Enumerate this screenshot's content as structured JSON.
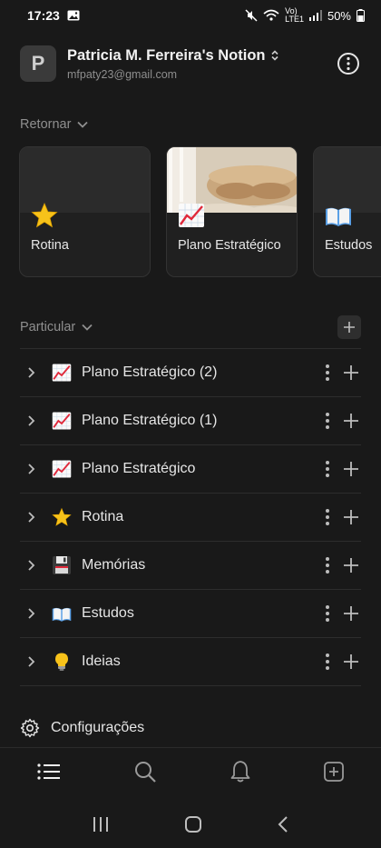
{
  "status": {
    "time": "17:23",
    "battery": "50%",
    "network": "VoLTE1",
    "lte": "LTE1"
  },
  "workspace": {
    "initial": "P",
    "name": "Patricia M. Ferreira's Notion",
    "email": "mfpaty23@gmail.com"
  },
  "recent": {
    "title": "Retornar",
    "cards": [
      {
        "label": "Rotina",
        "icon": "star-icon"
      },
      {
        "label": "Plano Estratégico",
        "icon": "chart-increasing-icon"
      },
      {
        "label": "Estudos",
        "icon": "open-book-icon"
      }
    ]
  },
  "private": {
    "title": "Particular",
    "pages": [
      {
        "label": "Plano Estratégico (2)",
        "icon": "chart-increasing-icon"
      },
      {
        "label": "Plano Estratégico (1)",
        "icon": "chart-increasing-icon"
      },
      {
        "label": "Plano Estratégico",
        "icon": "chart-increasing-icon"
      },
      {
        "label": "Rotina",
        "icon": "star-icon"
      },
      {
        "label": "Memórias",
        "icon": "floppy-disk-icon"
      },
      {
        "label": "Estudos",
        "icon": "open-book-icon"
      },
      {
        "label": "Ideias",
        "icon": "light-bulb-icon"
      }
    ]
  },
  "settings": {
    "label": "Configurações"
  }
}
